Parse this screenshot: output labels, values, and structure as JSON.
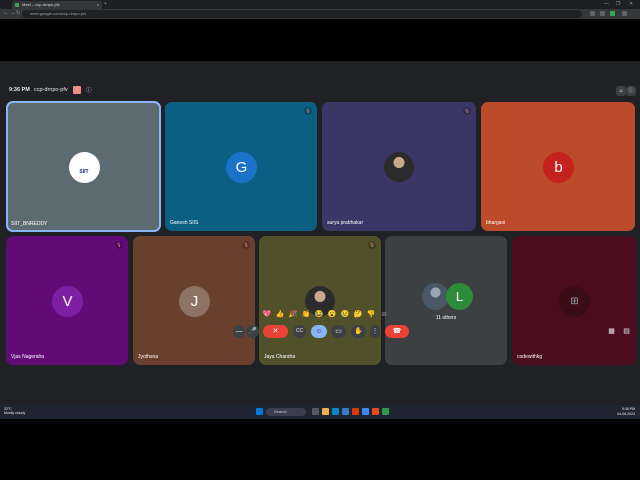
{
  "browser": {
    "tab_title": "Meet – ccp-drnpo-pfv",
    "url": "meet.google.com/ccp-drnpo-pfv",
    "tab_close": "×",
    "window_controls": [
      "—",
      "❐",
      "✕"
    ],
    "nav": [
      "←",
      "→",
      "↻"
    ]
  },
  "meet": {
    "time": "9:36 PM",
    "code": "ccp-drnpo-pfv",
    "info_icon": "ⓘ",
    "top_right": [
      "☺",
      "ⓘ"
    ]
  },
  "participants": [
    {
      "name": "SIIT_BNREDDY",
      "bg": "#5c6a72",
      "avatar_type": "logo",
      "logo_text": "SIIT",
      "active": true
    },
    {
      "name": "Ganesh SIIS",
      "bg": "#0b5f82",
      "avatar_type": "letter",
      "letter": "G",
      "avatar_color": "#1a73c8",
      "mic": "muted"
    },
    {
      "name": "surya prabhakar",
      "bg": "#3b3666",
      "avatar_type": "photo",
      "mic": "muted"
    },
    {
      "name": "bhargavi",
      "bg": "#bb4b2a",
      "avatar_type": "letter",
      "letter": "b",
      "avatar_color": "#c5221f"
    },
    {
      "name": "Vjas Nagendra",
      "bg": "#620b77",
      "avatar_type": "letter",
      "letter": "V",
      "avatar_color": "#7e1fa3",
      "mic": "muted"
    },
    {
      "name": "Jyothsna",
      "bg": "#69402e",
      "avatar_type": "letter",
      "letter": "J",
      "avatar_color": "#8f7266",
      "mic": "muted"
    },
    {
      "name": "Jaya Chandra",
      "bg": "#50502b",
      "avatar_type": "photo",
      "mic": "muted"
    },
    {
      "name": "11 others",
      "bg": "#3c4043",
      "avatar_type": "group",
      "letter": "L",
      "avatar_color": "#2e8b3a"
    },
    {
      "name": "codewithkg",
      "bg": "#4a0c1e",
      "avatar_type": "icon"
    }
  ],
  "reactions": [
    "💖",
    "👍",
    "🎉",
    "👏",
    "😂",
    "😮",
    "😢",
    "🤔",
    "👎",
    "☺"
  ],
  "controls": {
    "more": "—",
    "mic": "🎤",
    "cam_off": "✕",
    "caption": "CC",
    "emoji": "☺",
    "present": "▭",
    "raise_hand": "✋",
    "options": "⋮",
    "end_call": "☎"
  },
  "taskbar": {
    "weather_temp": "32°C",
    "weather_desc": "Mostly cloudy",
    "search": "Search",
    "time": "9:36 PM",
    "date": "04-06-2024"
  }
}
